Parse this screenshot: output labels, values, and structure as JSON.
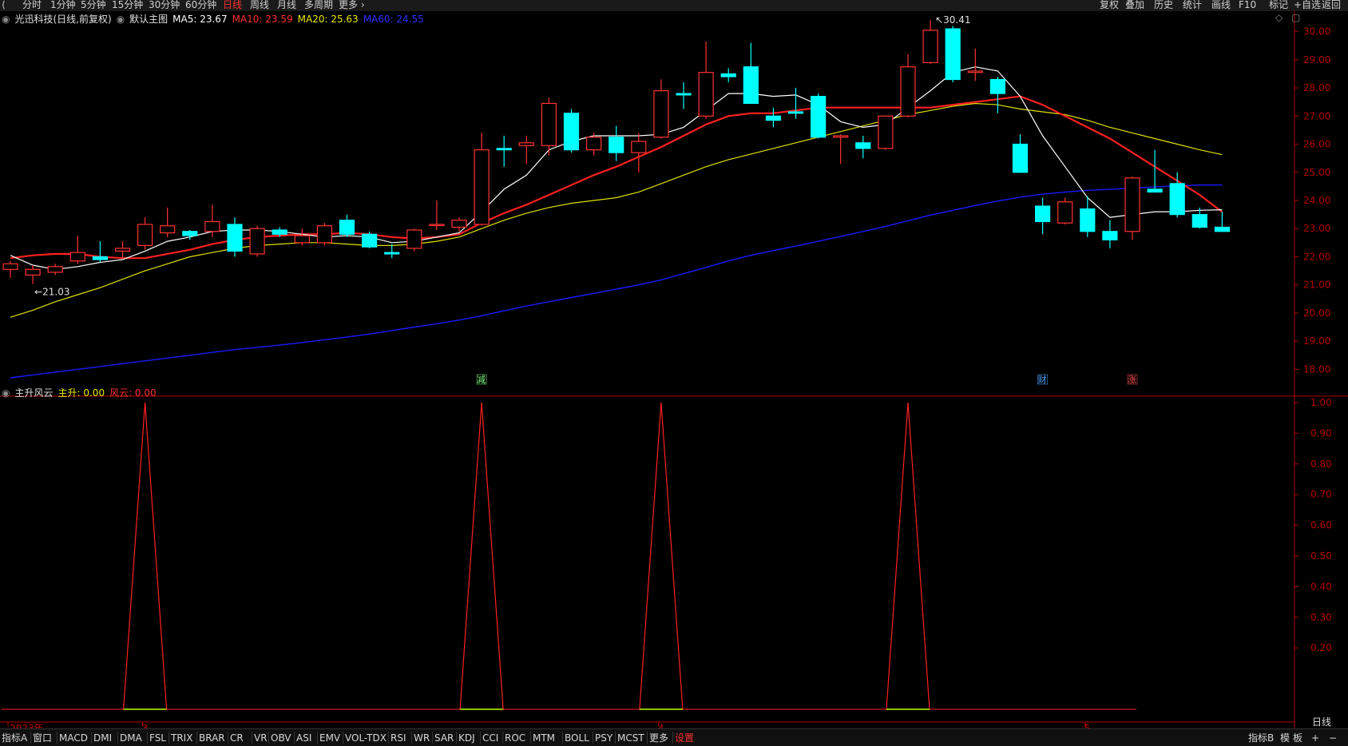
{
  "topbar": {
    "periods": [
      "分时",
      "1分钟",
      "5分钟",
      "15分钟",
      "30分钟",
      "60分钟",
      "日线",
      "周线",
      "月线",
      "多周期",
      "更多 ›"
    ],
    "active_period": "日线",
    "right_items": [
      "复权",
      "叠加",
      "历史",
      "统计",
      "画线",
      "F10",
      "标记",
      "+自选",
      "返回"
    ]
  },
  "main_legend": {
    "stock": "光迅科技(日线,前复权)",
    "template": "默认主图",
    "ma5": "MA5: 23.67",
    "ma10": "MA10: 23.59",
    "ma20": "MA20: 25.63",
    "ma60": "MA60: 24.55"
  },
  "colors": {
    "up": "#ff3232",
    "down": "#00ffff",
    "ma5": "#ffffff",
    "ma10": "#ff2020",
    "ma20": "#e0e000",
    "ma60": "#1a1aff",
    "axis": "#b00000",
    "sub_line": "#ff2020",
    "sub_base": "#c0ff00"
  },
  "sub_legend": {
    "name": "主升风云",
    "zhusheng": "主升: 0.00",
    "fengyun": "风云: 0.00"
  },
  "markers": [
    {
      "label": "减",
      "color": "#7fff7f",
      "index": 21
    },
    {
      "label": "财",
      "color": "#4da6ff",
      "index": 46
    },
    {
      "label": "涨",
      "color": "#ff5050",
      "index": 50
    }
  ],
  "price_annotations": {
    "high": "30.41",
    "low": "21.03"
  },
  "x_labels": [
    {
      "label": "2023年",
      "index": 0
    },
    {
      "label": "3",
      "index": 6
    },
    {
      "label": "4",
      "index": 29
    },
    {
      "label": "5",
      "index": 48
    }
  ],
  "right_corner": "日线",
  "bottombar": {
    "items": [
      "指标A",
      "窗口",
      "MACD",
      "DMI",
      "DMA",
      "FSL",
      "TRIX",
      "BRAR",
      "CR",
      "VR",
      "OBV",
      "ASI",
      "EMV",
      "VOL-TDX",
      "RSI",
      "WR",
      "SAR",
      "KDJ",
      "CCI",
      "ROC",
      "MTM",
      "BOLL",
      "PSY",
      "MCST",
      "更多",
      "设置"
    ],
    "active": "设置",
    "right_items": [
      "指标B",
      "模",
      "板",
      "+",
      "−"
    ]
  },
  "chart_data": {
    "type": "candlestick",
    "price_axis": {
      "range": [
        17.5,
        30.5
      ],
      "ticks": [
        18.0,
        19.0,
        20.0,
        21.0,
        22.0,
        23.0,
        24.0,
        25.0,
        26.0,
        27.0,
        28.0,
        29.0,
        30.0
      ]
    },
    "sub_axis": {
      "range": [
        0.0,
        1.0
      ],
      "ticks": [
        0.2,
        0.3,
        0.4,
        0.5,
        0.6,
        0.7,
        0.8,
        0.9,
        1.0
      ]
    },
    "candles": [
      {
        "o": 21.55,
        "h": 21.85,
        "l": 21.25,
        "c": 21.75
      },
      {
        "o": 21.35,
        "h": 21.7,
        "l": 21.03,
        "c": 21.55
      },
      {
        "o": 21.45,
        "h": 21.75,
        "l": 21.35,
        "c": 21.65
      },
      {
        "o": 21.85,
        "h": 22.75,
        "l": 21.75,
        "c": 22.15
      },
      {
        "o": 22.0,
        "h": 22.55,
        "l": 21.8,
        "c": 21.9
      },
      {
        "o": 22.2,
        "h": 22.55,
        "l": 21.95,
        "c": 22.3
      },
      {
        "o": 22.4,
        "h": 23.4,
        "l": 22.25,
        "c": 23.15
      },
      {
        "o": 22.85,
        "h": 23.75,
        "l": 22.7,
        "c": 23.1
      },
      {
        "o": 22.9,
        "h": 22.95,
        "l": 22.6,
        "c": 22.75
      },
      {
        "o": 22.9,
        "h": 23.85,
        "l": 22.7,
        "c": 23.25
      },
      {
        "o": 23.15,
        "h": 23.4,
        "l": 22.0,
        "c": 22.2
      },
      {
        "o": 22.1,
        "h": 23.1,
        "l": 22.0,
        "c": 23.0
      },
      {
        "o": 22.95,
        "h": 23.05,
        "l": 22.7,
        "c": 22.8
      },
      {
        "o": 22.5,
        "h": 23.0,
        "l": 22.4,
        "c": 22.75
      },
      {
        "o": 22.5,
        "h": 23.2,
        "l": 22.4,
        "c": 23.1
      },
      {
        "o": 23.3,
        "h": 23.5,
        "l": 22.7,
        "c": 22.8
      },
      {
        "o": 22.8,
        "h": 22.9,
        "l": 22.3,
        "c": 22.35
      },
      {
        "o": 22.15,
        "h": 22.45,
        "l": 21.95,
        "c": 22.1
      },
      {
        "o": 22.3,
        "h": 23.0,
        "l": 22.2,
        "c": 22.95
      },
      {
        "o": 23.15,
        "h": 24.0,
        "l": 22.95,
        "c": 23.15
      },
      {
        "o": 23.05,
        "h": 23.4,
        "l": 22.9,
        "c": 23.3
      },
      {
        "o": 23.15,
        "h": 26.4,
        "l": 23.1,
        "c": 25.8
      },
      {
        "o": 25.85,
        "h": 26.3,
        "l": 25.2,
        "c": 25.8
      },
      {
        "o": 25.95,
        "h": 26.3,
        "l": 25.3,
        "c": 26.05
      },
      {
        "o": 25.95,
        "h": 27.65,
        "l": 25.6,
        "c": 27.45
      },
      {
        "o": 27.1,
        "h": 27.25,
        "l": 25.7,
        "c": 25.8
      },
      {
        "o": 25.8,
        "h": 26.4,
        "l": 25.6,
        "c": 26.25
      },
      {
        "o": 26.25,
        "h": 26.65,
        "l": 25.4,
        "c": 25.7
      },
      {
        "o": 25.7,
        "h": 26.4,
        "l": 25.0,
        "c": 26.1
      },
      {
        "o": 26.25,
        "h": 28.3,
        "l": 26.2,
        "c": 27.9
      },
      {
        "o": 27.8,
        "h": 28.2,
        "l": 27.25,
        "c": 27.75
      },
      {
        "o": 27.0,
        "h": 29.65,
        "l": 26.9,
        "c": 28.55
      },
      {
        "o": 28.5,
        "h": 28.7,
        "l": 28.2,
        "c": 28.4
      },
      {
        "o": 28.75,
        "h": 29.6,
        "l": 27.45,
        "c": 27.45
      },
      {
        "o": 27.0,
        "h": 27.3,
        "l": 26.6,
        "c": 26.85
      },
      {
        "o": 27.15,
        "h": 28.0,
        "l": 26.9,
        "c": 27.1
      },
      {
        "o": 27.7,
        "h": 27.8,
        "l": 26.2,
        "c": 26.25
      },
      {
        "o": 26.25,
        "h": 26.35,
        "l": 25.3,
        "c": 26.3
      },
      {
        "o": 26.05,
        "h": 26.3,
        "l": 25.5,
        "c": 25.85
      },
      {
        "o": 25.85,
        "h": 27.0,
        "l": 25.8,
        "c": 27.0
      },
      {
        "o": 27.0,
        "h": 29.2,
        "l": 26.95,
        "c": 28.75
      },
      {
        "o": 28.9,
        "h": 30.41,
        "l": 28.85,
        "c": 30.05
      },
      {
        "o": 30.1,
        "h": 30.2,
        "l": 28.2,
        "c": 28.3
      },
      {
        "o": 28.55,
        "h": 29.4,
        "l": 28.25,
        "c": 28.6
      },
      {
        "o": 28.3,
        "h": 28.4,
        "l": 27.1,
        "c": 27.8
      },
      {
        "o": 26.0,
        "h": 26.35,
        "l": 25.0,
        "c": 25.0
      },
      {
        "o": 23.8,
        "h": 24.1,
        "l": 22.8,
        "c": 23.25
      },
      {
        "o": 23.2,
        "h": 24.1,
        "l": 23.15,
        "c": 23.95
      },
      {
        "o": 23.7,
        "h": 24.15,
        "l": 22.7,
        "c": 22.9
      },
      {
        "o": 22.9,
        "h": 23.3,
        "l": 22.3,
        "c": 22.6
      },
      {
        "o": 22.9,
        "h": 24.85,
        "l": 22.6,
        "c": 24.8
      },
      {
        "o": 24.4,
        "h": 25.8,
        "l": 24.3,
        "c": 24.3
      },
      {
        "o": 24.6,
        "h": 25.0,
        "l": 23.4,
        "c": 23.5
      },
      {
        "o": 23.5,
        "h": 23.75,
        "l": 23.0,
        "c": 23.05
      },
      {
        "o": 23.05,
        "h": 23.6,
        "l": 22.9,
        "c": 22.9
      }
    ],
    "series": [
      {
        "name": "MA5",
        "values": [
          22.05,
          21.7,
          21.55,
          21.65,
          21.8,
          21.9,
          22.2,
          22.55,
          22.7,
          22.9,
          22.95,
          22.95,
          22.9,
          22.8,
          22.7,
          22.75,
          22.7,
          22.5,
          22.55,
          22.7,
          22.85,
          23.6,
          24.4,
          24.9,
          25.8,
          26.1,
          26.3,
          26.3,
          26.3,
          26.35,
          26.6,
          27.2,
          27.8,
          27.8,
          27.7,
          27.75,
          27.4,
          26.8,
          26.6,
          26.7,
          27.3,
          27.9,
          28.55,
          28.75,
          28.6,
          27.7,
          26.3,
          25.2,
          24.1,
          23.4,
          23.5,
          23.6,
          23.6,
          23.65,
          23.67
        ]
      },
      {
        "name": "MA10",
        "values": [
          21.95,
          22.05,
          22.1,
          22.1,
          22.0,
          21.95,
          21.95,
          22.1,
          22.25,
          22.45,
          22.6,
          22.7,
          22.75,
          22.8,
          22.8,
          22.85,
          22.8,
          22.7,
          22.65,
          22.7,
          22.8,
          23.2,
          23.55,
          23.85,
          24.2,
          24.55,
          24.9,
          25.2,
          25.55,
          25.9,
          26.3,
          26.7,
          27.0,
          27.1,
          27.1,
          27.2,
          27.3,
          27.3,
          27.3,
          27.3,
          27.3,
          27.3,
          27.4,
          27.5,
          27.6,
          27.7,
          27.4,
          27.0,
          26.6,
          26.2,
          25.7,
          25.2,
          24.7,
          24.2,
          23.59
        ]
      },
      {
        "name": "MA20",
        "values": [
          19.85,
          20.1,
          20.4,
          20.65,
          20.9,
          21.2,
          21.5,
          21.75,
          22.0,
          22.15,
          22.3,
          22.4,
          22.45,
          22.5,
          22.5,
          22.45,
          22.4,
          22.4,
          22.45,
          22.55,
          22.7,
          23.0,
          23.3,
          23.55,
          23.75,
          23.9,
          24.0,
          24.1,
          24.3,
          24.6,
          24.9,
          25.2,
          25.45,
          25.65,
          25.85,
          26.05,
          26.25,
          26.45,
          26.65,
          26.85,
          27.05,
          27.2,
          27.35,
          27.45,
          27.4,
          27.25,
          27.15,
          27.05,
          26.85,
          26.6,
          26.4,
          26.2,
          26.0,
          25.8,
          25.63
        ]
      },
      {
        "name": "MA60",
        "values": [
          17.7,
          17.8,
          17.9,
          18.0,
          18.1,
          18.2,
          18.3,
          18.4,
          18.5,
          18.6,
          18.7,
          18.78,
          18.86,
          18.95,
          19.05,
          19.15,
          19.25,
          19.38,
          19.5,
          19.62,
          19.75,
          19.9,
          20.08,
          20.25,
          20.4,
          20.55,
          20.7,
          20.85,
          21.0,
          21.18,
          21.4,
          21.62,
          21.85,
          22.05,
          22.22,
          22.38,
          22.55,
          22.72,
          22.9,
          23.08,
          23.28,
          23.48,
          23.65,
          23.82,
          23.98,
          24.12,
          24.22,
          24.3,
          24.36,
          24.4,
          24.44,
          24.48,
          24.52,
          24.55,
          24.55
        ]
      }
    ],
    "sub_series": [
      {
        "name": "主升",
        "peaks": [
          6,
          21,
          29,
          40
        ],
        "value": 1.0
      }
    ]
  }
}
